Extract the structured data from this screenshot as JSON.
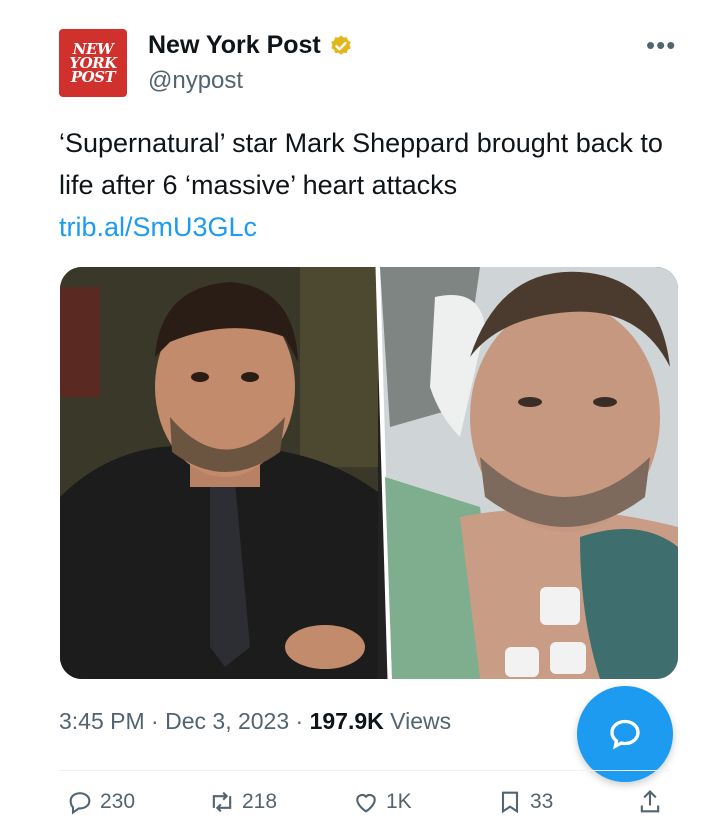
{
  "tweet": {
    "author_name": "New York Post",
    "author_handle": "@nypost",
    "avatar_text": [
      "NEW",
      "YORK",
      "POST"
    ],
    "text_line": "‘Supernatural’ star Mark Sheppard brought back to life after 6 ‘massive’ heart attacks",
    "link": "trib.al/SmU3GLc",
    "time": "3:45 PM",
    "separator": "·",
    "date": "Dec 3, 2023",
    "views_count": "197.9K",
    "views_label": "Views"
  },
  "actions": {
    "replies": "230",
    "reposts": "218",
    "likes": "1K",
    "bookmarks": "33"
  },
  "icons": {
    "more": "more-horizontal-icon",
    "verified": "verified-gold-badge-icon",
    "compose": "compose-reply-icon",
    "reply": "reply-icon",
    "repost": "repost-icon",
    "like": "heart-icon",
    "bookmark": "bookmark-icon",
    "share": "share-icon"
  },
  "colors": {
    "accent": "#1d9bf0",
    "muted": "#536471",
    "brand_red": "#d0312d",
    "verified_gold": "#e2b719"
  }
}
